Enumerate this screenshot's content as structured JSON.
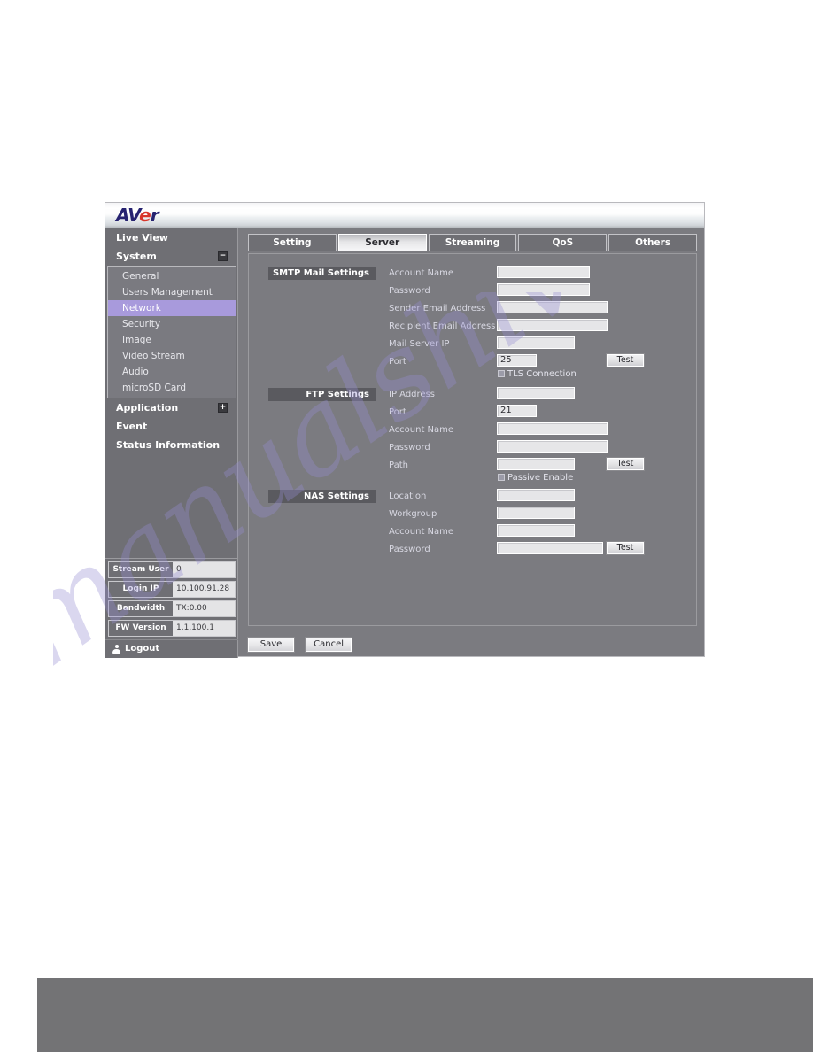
{
  "brand": {
    "logo_av": "AV",
    "logo_e": "e",
    "logo_r": "r",
    "logo_full": "AVer"
  },
  "sidebar": {
    "groups": [
      {
        "label": "Live View",
        "expander": ""
      },
      {
        "label": "System",
        "expander": "−"
      }
    ],
    "system_submenu": [
      {
        "label": "General",
        "active": false
      },
      {
        "label": "Users Management",
        "active": false
      },
      {
        "label": "Network",
        "active": true
      },
      {
        "label": "Security",
        "active": false
      },
      {
        "label": "Image",
        "active": false
      },
      {
        "label": "Video Stream",
        "active": false
      },
      {
        "label": "Audio",
        "active": false
      },
      {
        "label": "microSD Card",
        "active": false
      }
    ],
    "groups_after": [
      {
        "label": "Application",
        "expander": "+"
      },
      {
        "label": "Event",
        "expander": ""
      },
      {
        "label": "Status Information",
        "expander": ""
      }
    ],
    "status": [
      {
        "label": "Stream User",
        "value": "0"
      },
      {
        "label": "Login IP",
        "value": "10.100.91.28"
      },
      {
        "label": "Bandwidth",
        "value": "TX:0.00"
      },
      {
        "label": "FW Version",
        "value": "1.1.100.1"
      }
    ],
    "logout_label": "Logout"
  },
  "tabs": [
    {
      "label": "Setting",
      "active": false
    },
    {
      "label": "Server",
      "active": true
    },
    {
      "label": "Streaming",
      "active": false
    },
    {
      "label": "QoS",
      "active": false
    },
    {
      "label": "Others",
      "active": false
    }
  ],
  "sections": {
    "smtp": {
      "title": "SMTP Mail Settings",
      "fields": [
        {
          "label": "Account Name",
          "value": ""
        },
        {
          "label": "Password",
          "value": ""
        },
        {
          "label": "Sender Email Address",
          "value": ""
        },
        {
          "label": "Recipient Email Address",
          "value": ""
        },
        {
          "label": "Mail Server IP",
          "value": ""
        },
        {
          "label": "Port",
          "value": "25"
        }
      ],
      "checkbox_label": "TLS Connection",
      "test_label": "Test"
    },
    "ftp": {
      "title": "FTP Settings",
      "fields": [
        {
          "label": "IP Address",
          "value": ""
        },
        {
          "label": "Port",
          "value": "21"
        },
        {
          "label": "Account Name",
          "value": ""
        },
        {
          "label": "Password",
          "value": ""
        },
        {
          "label": "Path",
          "value": ""
        }
      ],
      "checkbox_label": "Passive Enable",
      "test_label": "Test"
    },
    "nas": {
      "title": "NAS Settings",
      "fields": [
        {
          "label": "Location",
          "value": ""
        },
        {
          "label": "Workgroup",
          "value": ""
        },
        {
          "label": "Account Name",
          "value": ""
        },
        {
          "label": "Password",
          "value": ""
        }
      ],
      "test_label": "Test"
    }
  },
  "actions": {
    "save_label": "Save",
    "cancel_label": "Cancel"
  },
  "watermark": {
    "text": "manualshive.com"
  },
  "colors": {
    "panel_bg": "#7b7b80",
    "sidebar_bg": "#6f6f74",
    "accent_highlight": "#a89adc",
    "section_label_bg": "#5a5a5f",
    "input_bg": "#e6e6e8",
    "logo_blue": "#262270",
    "logo_red": "#d8352a",
    "footer_bar": "#737375"
  }
}
